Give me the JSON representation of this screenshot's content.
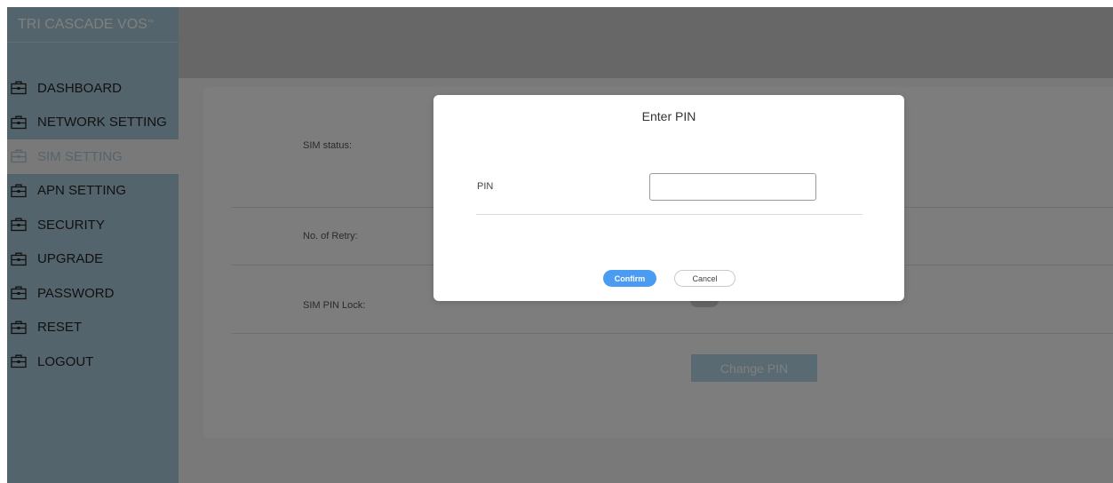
{
  "sidebar": {
    "logo": "TRI CASCADE VOS",
    "logo_mark": "™",
    "items": [
      {
        "label": "DASHBOARD",
        "icon": "briefcase-icon"
      },
      {
        "label": "NETWORK SETTING",
        "icon": "briefcase-icon"
      },
      {
        "label": "SIM SETTING",
        "icon": "briefcase-icon",
        "active": true
      },
      {
        "label": "APN SETTING",
        "icon": "briefcase-icon"
      },
      {
        "label": "SECURITY",
        "icon": "briefcase-icon"
      },
      {
        "label": "UPGRADE",
        "icon": "briefcase-icon"
      },
      {
        "label": "PASSWORD",
        "icon": "briefcase-icon"
      },
      {
        "label": "RESET",
        "icon": "briefcase-icon"
      },
      {
        "label": "LOGOUT",
        "icon": "briefcase-icon"
      }
    ]
  },
  "main": {
    "rows": [
      {
        "label": "SIM status:"
      },
      {
        "label": "No. of Retry:"
      },
      {
        "label": "SIM PIN Lock:"
      }
    ],
    "change_pin_label": "Change PIN"
  },
  "modal": {
    "title": "Enter PIN",
    "pin_label": "PIN",
    "pin_value": "",
    "confirm_label": "Confirm",
    "cancel_label": "Cancel"
  },
  "colors": {
    "sidebar_bg": "#a9c9d8",
    "active_text": "#a9c9d8",
    "confirm_bg": "#4a9cf2",
    "change_pin_bg": "#b4d5e4"
  }
}
